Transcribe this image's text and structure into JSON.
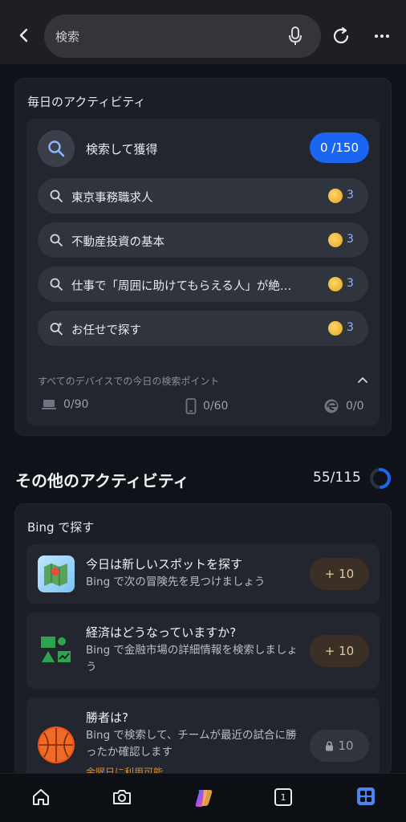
{
  "topbar": {
    "search_text": "検索"
  },
  "daily": {
    "title": "毎日のアクティビティ",
    "search_earn_label": "検索して獲得",
    "progress": "0 /150",
    "queries": [
      {
        "text": "東京事務職求人",
        "points": "3"
      },
      {
        "text": "不動産投資の基本",
        "points": "3"
      },
      {
        "text": "仕事で「周囲に助けてもらえる人」が絶…",
        "points": "3"
      },
      {
        "text": "お任せで探す",
        "points": "3"
      }
    ],
    "device_caption": "すべてのデバイスでの今日の検索ポイント",
    "devices": {
      "pc": "0/90",
      "mobile": "0/60",
      "edge": "0/0"
    }
  },
  "other": {
    "title": "その他のアクティビティ",
    "score": "55/115",
    "progress_fraction": 0.478
  },
  "bing": {
    "title": "Bing で探す",
    "activities": [
      {
        "title": "今日は新しいスポットを探す",
        "desc": "Bing で次の冒険先を見つけましょう",
        "points": "+ 10"
      },
      {
        "title": "経済はどうなっていますか?",
        "desc": "Bing で金融市場の詳細情報を検索しましょう",
        "points": "+ 10"
      },
      {
        "title": "勝者は?",
        "desc": "Bing で検索して、チームが最近の試合に勝ったか確認します",
        "points": "10",
        "note": "金曜日に利用可能"
      }
    ]
  },
  "nav": {
    "tab_count": "1"
  },
  "colors": {
    "accent": "#1a66f0",
    "coin": "#e0a420",
    "points_text": "#8fb4ff"
  }
}
